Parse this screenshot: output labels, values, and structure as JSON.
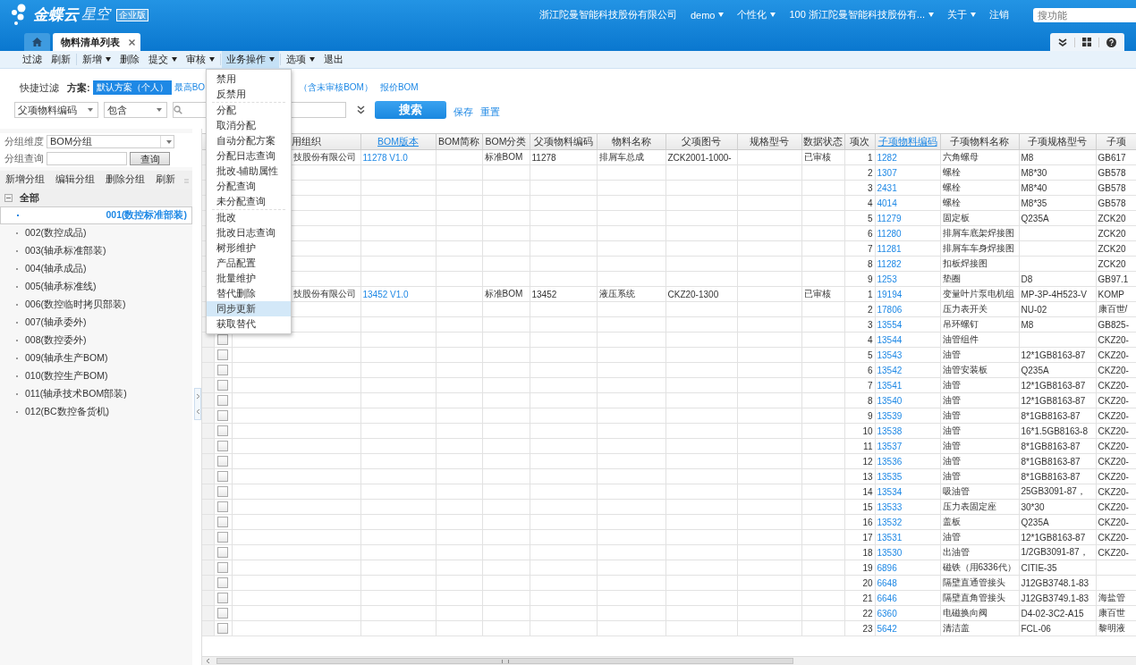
{
  "header": {
    "brand": "金蝶云",
    "product": "星空",
    "edition": "企业版",
    "nav": [
      {
        "label": "浙江陀曼智能科技股份有限公司",
        "dropdown": false
      },
      {
        "label": "demo",
        "dropdown": true
      },
      {
        "label": "个性化",
        "dropdown": true
      },
      {
        "label": "100  浙江陀曼智能科技股份有...",
        "dropdown": true
      },
      {
        "label": "关于",
        "dropdown": true
      },
      {
        "label": "注销",
        "dropdown": false
      }
    ],
    "search": {
      "placeholder": "搜功能"
    },
    "tabs": [
      {
        "kind": "home",
        "selected": false
      },
      {
        "kind": "page",
        "label": "物料清单列表",
        "selected": true
      }
    ]
  },
  "toolbar": [
    [
      {
        "label": "过滤",
        "dropdown": false,
        "open": false
      },
      {
        "label": "刷新",
        "dropdown": false,
        "open": false
      }
    ],
    [
      {
        "label": "新增",
        "dropdown": true,
        "open": false
      },
      {
        "label": "删除",
        "dropdown": false,
        "open": false
      },
      {
        "label": "提交",
        "dropdown": true,
        "open": false
      },
      {
        "label": "审核",
        "dropdown": true,
        "open": false
      }
    ],
    [
      {
        "label": "业务操作",
        "dropdown": true,
        "open": true
      }
    ],
    [
      {
        "label": "选项",
        "dropdown": true,
        "open": false
      },
      {
        "label": "退出",
        "dropdown": false,
        "open": false
      }
    ]
  ],
  "menu": [
    [
      {
        "label": "禁用",
        "selected": false
      },
      {
        "label": "反禁用",
        "selected": false
      }
    ],
    [
      {
        "label": "分配",
        "selected": false
      },
      {
        "label": "取消分配",
        "selected": false
      },
      {
        "label": "自动分配方案",
        "selected": false
      },
      {
        "label": "分配日志查询",
        "selected": false
      },
      {
        "label": "批改-辅助属性",
        "selected": false
      },
      {
        "label": "分配查询",
        "selected": false
      },
      {
        "label": "未分配查询",
        "selected": false
      }
    ],
    [
      {
        "label": "批改",
        "selected": false
      },
      {
        "label": "批改日志查询",
        "selected": false
      },
      {
        "label": "树形维护",
        "selected": false
      },
      {
        "label": "产品配置",
        "selected": false
      },
      {
        "label": "批量维护",
        "selected": false
      },
      {
        "label": "替代删除",
        "selected": false
      },
      {
        "label": "同步更新",
        "selected": true
      },
      {
        "label": "获取替代",
        "selected": false
      }
    ]
  ],
  "quick_filter": {
    "label": "快捷过滤",
    "scheme_label": "方案:",
    "schemes": [
      {
        "label": "默认方案（个人）",
        "selected": true
      },
      {
        "label": "最高BO",
        "selected": false
      },
      {
        "label": "（含未审核BOM）",
        "selected": false
      },
      {
        "label": "报价BOM",
        "selected": false
      }
    ],
    "field": "父项物料编码",
    "operator": "包含",
    "search_button": "搜索",
    "save": "保存",
    "reset": "重置"
  },
  "group_panel": {
    "dimension_label": "分组维度",
    "dimension": "BOM分组",
    "query_label": "分组查询",
    "query_button": "查询",
    "actions": [
      "新增分组",
      "编辑分组",
      "删除分组",
      "刷新"
    ],
    "tree": [
      {
        "label": "全部",
        "expanded": true,
        "selected": false,
        "children": [
          {
            "label": "001(数控标准部装)",
            "selected": true
          },
          {
            "label": "002(数控成品)",
            "selected": false
          },
          {
            "label": "003(轴承标准部装)",
            "selected": false
          },
          {
            "label": "004(轴承成品)",
            "selected": false
          },
          {
            "label": "005(轴承标准线)",
            "selected": false
          },
          {
            "label": "006(数控临时拷贝部装)",
            "selected": false
          },
          {
            "label": "007(轴承委外)",
            "selected": false
          },
          {
            "label": "008(数控委外)",
            "selected": false
          },
          {
            "label": "009(轴承生产BOM)",
            "selected": false
          },
          {
            "label": "010(数控生产BOM)",
            "selected": false
          },
          {
            "label": "011(轴承技术BOM部装)",
            "selected": false
          },
          {
            "label": "012(BC数控备货机)",
            "selected": false
          }
        ]
      }
    ]
  },
  "grid": {
    "columns": [
      {
        "label": "用组织",
        "linked": false
      },
      {
        "label": "BOM版本",
        "linked": true
      },
      {
        "label": "BOM简称",
        "linked": false
      },
      {
        "label": "BOM分类",
        "linked": false
      },
      {
        "label": "父项物料编码",
        "linked": false
      },
      {
        "label": "物料名称",
        "linked": false
      },
      {
        "label": "父项图号",
        "linked": false
      },
      {
        "label": "规格型号",
        "linked": false
      },
      {
        "label": "数据状态",
        "linked": false
      },
      {
        "label": "项次",
        "linked": false
      },
      {
        "label": "子项物料编码",
        "linked": true
      },
      {
        "label": "子项物料名称",
        "linked": false
      },
      {
        "label": "子项规格型号",
        "linked": false
      },
      {
        "label": "子项",
        "linked": false
      }
    ],
    "rows": [
      {
        "cells": [
          "技股份有限公司",
          "11278 V1.0",
          null,
          "标准BOM",
          "11278",
          "排屑车总成",
          "ZCK2001-1000-",
          null,
          "已审核",
          "1",
          "1282",
          "六角螺母",
          "M8",
          "GB617"
        ]
      },
      {
        "cells": [
          null,
          null,
          null,
          null,
          null,
          null,
          null,
          null,
          null,
          "2",
          "1307",
          "螺栓",
          "M8*30",
          "GB578"
        ]
      },
      {
        "cells": [
          null,
          null,
          null,
          null,
          null,
          null,
          null,
          null,
          null,
          "3",
          "2431",
          "螺栓",
          "M8*40",
          "GB578"
        ]
      },
      {
        "cells": [
          null,
          null,
          null,
          null,
          null,
          null,
          null,
          null,
          null,
          "4",
          "4014",
          "螺栓",
          "M8*35",
          "GB578"
        ]
      },
      {
        "cells": [
          null,
          null,
          null,
          null,
          null,
          null,
          null,
          null,
          null,
          "5",
          "11279",
          "固定板",
          "Q235A",
          "ZCK20"
        ]
      },
      {
        "cells": [
          null,
          null,
          null,
          null,
          null,
          null,
          null,
          null,
          null,
          "6",
          "11280",
          "排屑车底架焊接图",
          null,
          "ZCK20"
        ]
      },
      {
        "cells": [
          null,
          null,
          null,
          null,
          null,
          null,
          null,
          null,
          null,
          "7",
          "11281",
          "排屑车车身焊接图",
          null,
          "ZCK20"
        ]
      },
      {
        "cells": [
          null,
          null,
          null,
          null,
          null,
          null,
          null,
          null,
          null,
          "8",
          "11282",
          "扣板焊接图",
          null,
          "ZCK20"
        ]
      },
      {
        "cells": [
          null,
          null,
          null,
          null,
          null,
          null,
          null,
          null,
          null,
          "9",
          "1253",
          "垫圈",
          "D8",
          "GB97.1"
        ]
      },
      {
        "cells": [
          "技股份有限公司",
          "13452 V1.0",
          null,
          "标准BOM",
          "13452",
          "液压系统",
          "CKZ20-1300",
          null,
          "已审核",
          "1",
          "19194",
          "变量叶片泵电机组",
          "MP-3P-4H523-V",
          "KOMP"
        ]
      },
      {
        "cells": [
          null,
          null,
          null,
          null,
          null,
          null,
          null,
          null,
          null,
          "2",
          "17806",
          "压力表开关",
          "NU-02",
          "康百世/"
        ]
      },
      {
        "cells": [
          null,
          null,
          null,
          null,
          null,
          null,
          null,
          null,
          null,
          "3",
          "13554",
          "吊环螺钉",
          "M8",
          "GB825-"
        ]
      },
      {
        "checked": false,
        "cells": [
          null,
          null,
          null,
          null,
          null,
          null,
          null,
          null,
          null,
          "4",
          "13544",
          "油管组件",
          null,
          "CKZ20-"
        ]
      },
      {
        "checked": false,
        "cells": [
          null,
          null,
          null,
          null,
          null,
          null,
          null,
          null,
          null,
          "5",
          "13543",
          "油管",
          "12*1GB8163-87",
          "CKZ20-"
        ]
      },
      {
        "checked": false,
        "cells": [
          null,
          null,
          null,
          null,
          null,
          null,
          null,
          null,
          null,
          "6",
          "13542",
          "油管安装板",
          "Q235A",
          "CKZ20-"
        ]
      },
      {
        "checked": false,
        "cells": [
          null,
          null,
          null,
          null,
          null,
          null,
          null,
          null,
          null,
          "7",
          "13541",
          "油管",
          "12*1GB8163-87",
          "CKZ20-"
        ]
      },
      {
        "checked": false,
        "cells": [
          null,
          null,
          null,
          null,
          null,
          null,
          null,
          null,
          null,
          "8",
          "13540",
          "油管",
          "12*1GB8163-87",
          "CKZ20-"
        ]
      },
      {
        "checked": false,
        "cells": [
          null,
          null,
          null,
          null,
          null,
          null,
          null,
          null,
          null,
          "9",
          "13539",
          "油管",
          "8*1GB8163-87",
          "CKZ20-"
        ]
      },
      {
        "checked": false,
        "cells": [
          null,
          null,
          null,
          null,
          null,
          null,
          null,
          null,
          null,
          "10",
          "13538",
          "油管",
          "16*1.5GB8163-8",
          "CKZ20-"
        ]
      },
      {
        "checked": false,
        "cells": [
          null,
          null,
          null,
          null,
          null,
          null,
          null,
          null,
          null,
          "11",
          "13537",
          "油管",
          "8*1GB8163-87",
          "CKZ20-"
        ]
      },
      {
        "checked": false,
        "cells": [
          null,
          null,
          null,
          null,
          null,
          null,
          null,
          null,
          null,
          "12",
          "13536",
          "油管",
          "8*1GB8163-87",
          "CKZ20-"
        ]
      },
      {
        "checked": false,
        "cells": [
          null,
          null,
          null,
          null,
          null,
          null,
          null,
          null,
          null,
          "13",
          "13535",
          "油管",
          "8*1GB8163-87",
          "CKZ20-"
        ]
      },
      {
        "checked": false,
        "cells": [
          null,
          null,
          null,
          null,
          null,
          null,
          null,
          null,
          null,
          "14",
          "13534",
          "吸油管",
          "25GB3091-87，",
          "CKZ20-"
        ]
      },
      {
        "checked": false,
        "cells": [
          null,
          null,
          null,
          null,
          null,
          null,
          null,
          null,
          null,
          "15",
          "13533",
          "压力表固定座",
          "30*30",
          "CKZ20-"
        ]
      },
      {
        "checked": false,
        "cells": [
          null,
          null,
          null,
          null,
          null,
          null,
          null,
          null,
          null,
          "16",
          "13532",
          "盖板",
          "Q235A",
          "CKZ20-"
        ]
      },
      {
        "checked": false,
        "cells": [
          null,
          null,
          null,
          null,
          null,
          null,
          null,
          null,
          null,
          "17",
          "13531",
          "油管",
          "12*1GB8163-87",
          "CKZ20-"
        ]
      },
      {
        "checked": false,
        "cells": [
          null,
          null,
          null,
          null,
          null,
          null,
          null,
          null,
          null,
          "18",
          "13530",
          "出油管",
          "1/2GB3091-87，",
          "CKZ20-"
        ]
      },
      {
        "checked": false,
        "cells": [
          null,
          null,
          null,
          null,
          null,
          null,
          null,
          null,
          null,
          "19",
          "6896",
          "磁铁（用6336代）",
          "CITIE-35",
          null
        ]
      },
      {
        "checked": false,
        "cells": [
          null,
          null,
          null,
          null,
          null,
          null,
          null,
          null,
          null,
          "20",
          "6648",
          "隔壁直通管接头",
          "J12GB3748.1-83",
          null
        ]
      },
      {
        "checked": false,
        "cells": [
          null,
          null,
          null,
          null,
          null,
          null,
          null,
          null,
          null,
          "21",
          "6646",
          "隔壁直角管接头",
          "J12GB3749.1-83",
          "海盐管"
        ]
      },
      {
        "checked": false,
        "cells": [
          null,
          null,
          null,
          null,
          null,
          null,
          null,
          null,
          null,
          "22",
          "6360",
          "电磁换向阀",
          "D4-02-3C2-A15",
          "康百世"
        ]
      },
      {
        "checked": false,
        "cells": [
          null,
          null,
          null,
          null,
          null,
          null,
          null,
          null,
          null,
          "23",
          "5642",
          "清洁盖",
          "FCL-06",
          "黎明液"
        ]
      }
    ]
  }
}
